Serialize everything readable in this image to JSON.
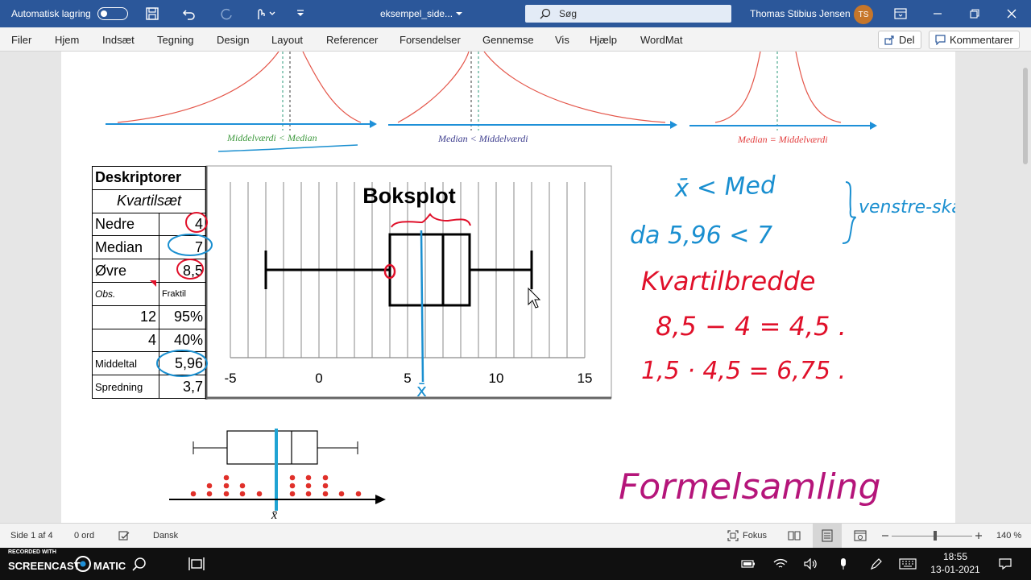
{
  "titlebar": {
    "autosave_label": "Automatisk lagring",
    "doc_title": "eksempel_side...",
    "search_placeholder": "Søg",
    "user_name": "Thomas Stibius Jensen",
    "user_initials": "TS"
  },
  "ribbon": {
    "tabs": [
      "Filer",
      "Hjem",
      "Indsæt",
      "Tegning",
      "Design",
      "Layout",
      "Referencer",
      "Forsendelser",
      "Gennemse",
      "Vis",
      "Hjælp",
      "WordMat"
    ],
    "share_label": "Del",
    "comments_label": "Kommentarer"
  },
  "document": {
    "skew_captions": {
      "left": "Middelværdi < Median",
      "middle": "Median < Middelværdi",
      "right": "Median = Middelværdi"
    },
    "table": {
      "header": "Deskriptorer",
      "subheader": "Kvartilsæt",
      "rows": [
        {
          "label": "Nedre",
          "value": "4"
        },
        {
          "label": "Median",
          "value": "7"
        },
        {
          "label": "Øvre",
          "value": "8,5"
        }
      ],
      "obs_label": "Obs.",
      "fraktil_label": "Fraktil",
      "fraktil_rows": [
        {
          "obs": "12",
          "pct": "95%"
        },
        {
          "obs": "4",
          "pct": "40%"
        }
      ],
      "mean_label": "Middeltal",
      "mean_value": "5,96",
      "spread_label": "Spredning",
      "spread_value": "3,7"
    },
    "boxplot": {
      "title": "Boksplot",
      "axis_ticks": [
        "-5",
        "0",
        "5",
        "10",
        "15"
      ],
      "axis_min": -5,
      "axis_max": 15,
      "whisker_min": -3,
      "q1": 4,
      "median": 7,
      "q3": 8.5,
      "whisker_max": 12,
      "mean": 5.96
    },
    "handwriting": {
      "line1": "x̄ < Med",
      "line2": "da 5,96 < 7",
      "venstreskaev": "venstre-skæv",
      "kvartil_title": "Kvartilbredde",
      "kvartil_calc": "8,5 − 4 = 4,5 .",
      "factor_calc": "1,5 · 4,5 = 6,75 .",
      "formel": "Formelsamling",
      "xbar_mark": "x̄",
      "ink_blue": "#1a8fd0",
      "ink_red": "#e0102a",
      "ink_magenta": "#b5157a"
    },
    "small_plot": {
      "xbar_label": "x̄"
    }
  },
  "statusbar": {
    "page_label": "Side 1 af 4",
    "words_label": "0 ord",
    "language": "Dansk",
    "focus_label": "Fokus",
    "zoom_label": "140 %"
  },
  "taskbar": {
    "recorded_with": "RECORDED WITH",
    "brand_left": "SCREENCAST",
    "brand_right": "MATIC",
    "time": "18:55",
    "date": "13-01-2021"
  },
  "colors": {
    "word_blue": "#2b579a",
    "curve_red": "#e4564a",
    "axis_blue": "#1e90d8",
    "caption_green": "#3f9a3f",
    "caption_purple": "#3a3a8c",
    "caption_red": "#e23a3a"
  }
}
